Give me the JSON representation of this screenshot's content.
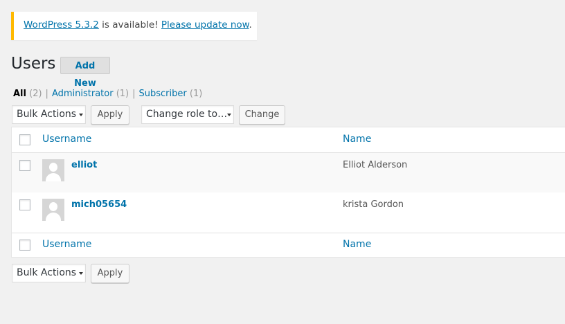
{
  "notice": {
    "link1": "WordPress 5.3.2",
    "text1": " is available! ",
    "link2": "Please update now",
    "text2": "."
  },
  "page": {
    "title": "Users",
    "add_new": "Add New"
  },
  "filters": [
    {
      "label": "All",
      "count": "(2)"
    },
    {
      "label": "Administrator",
      "count": "(1)"
    },
    {
      "label": "Subscriber",
      "count": "(1)"
    }
  ],
  "separator": "|",
  "controls": {
    "bulk_actions": "Bulk Actions",
    "apply": "Apply",
    "change_role": "Change role to…",
    "change": "Change"
  },
  "table": {
    "columns": {
      "username": "Username",
      "name": "Name"
    },
    "rows": [
      {
        "username": "elliot",
        "name": "Elliot Alderson"
      },
      {
        "username": "mich05654",
        "name": "krista Gordon"
      }
    ]
  },
  "colors": {
    "link": "#0073aa",
    "notice_accent": "#ffb900",
    "background": "#f1f1f1"
  }
}
